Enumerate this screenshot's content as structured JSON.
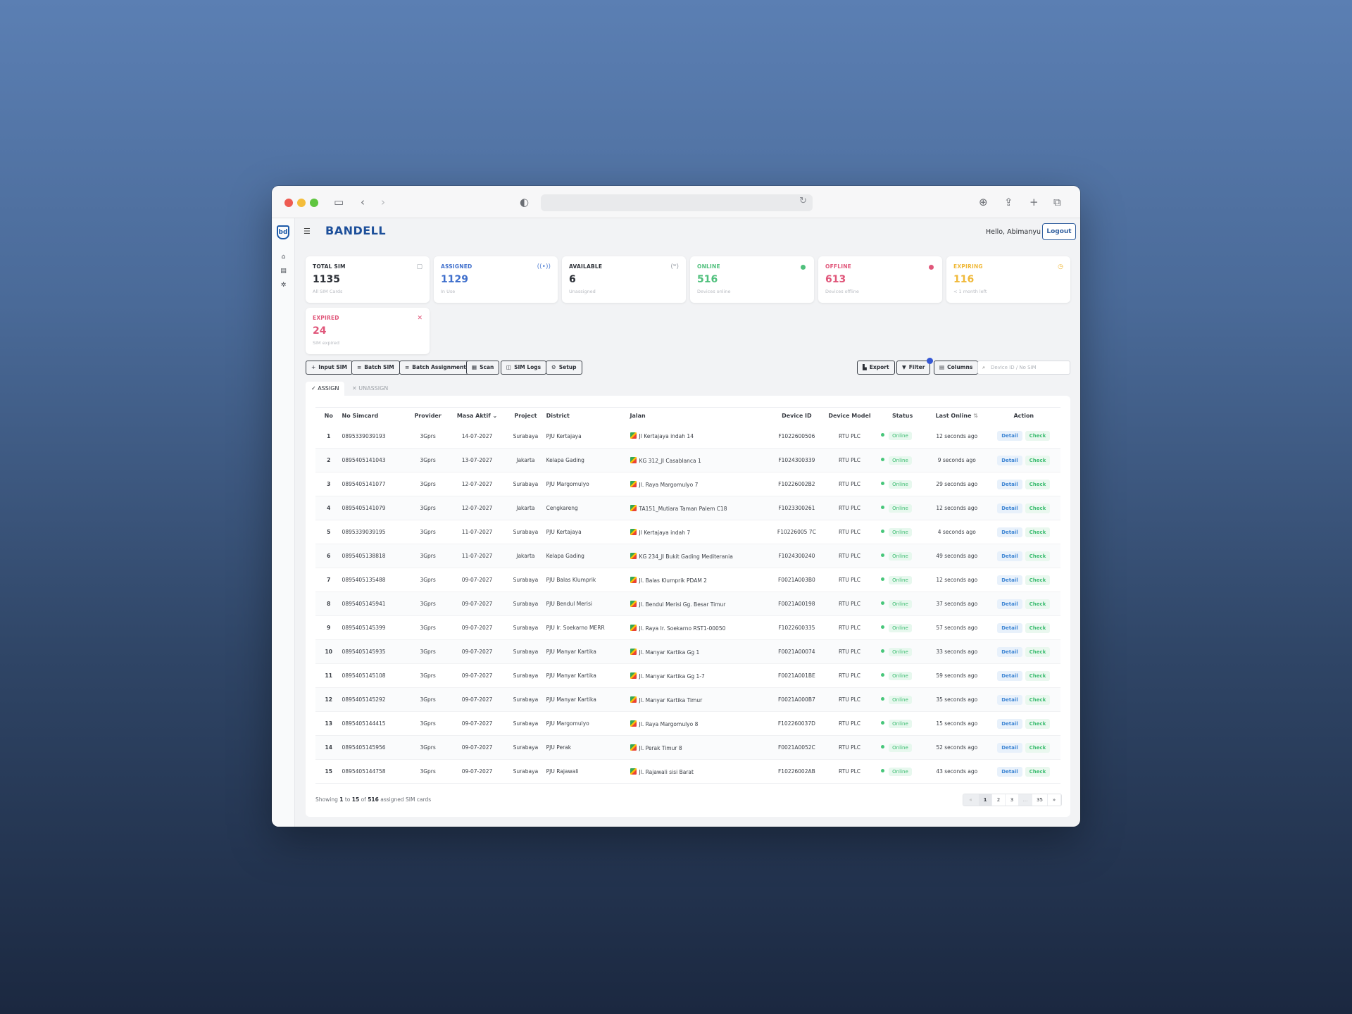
{
  "header": {
    "brand": "BANDELL",
    "greeting": "Hello, Abimanyu",
    "logout_label": "Logout"
  },
  "cards": [
    {
      "label": "TOTAL SIM",
      "value": "1135",
      "sub": "All SIM Cards",
      "color": "#2b2f36",
      "icon": "sim-card-icon"
    },
    {
      "label": "ASSIGNED",
      "value": "1129",
      "sub": "In Use",
      "color": "#3f6fcc",
      "icon": "signal-icon"
    },
    {
      "label": "AVAILABLE",
      "value": "6",
      "sub": "Unassigned",
      "color": "#2b2f36",
      "icon": "no-signal-icon"
    },
    {
      "label": "ONLINE",
      "value": "516",
      "sub": "Devices online",
      "color": "#4fc07c",
      "icon": "online-dot"
    },
    {
      "label": "OFFLINE",
      "value": "613",
      "sub": "Devices offline",
      "color": "#e0567a",
      "icon": "offline-dot"
    },
    {
      "label": "EXPIRING",
      "value": "116",
      "sub": "< 1 month left",
      "color": "#f0b93a",
      "icon": "clock-icon"
    },
    {
      "label": "EXPIRED",
      "value": "24",
      "sub": "SIM expired",
      "color": "#e0567a",
      "icon": "close-icon"
    }
  ],
  "toolbar": {
    "input_sim": "Input SIM",
    "batch_sim": "Batch SIM",
    "batch_assignment": "Batch Assignment",
    "scan": "Scan",
    "sim_logs": "SIM Logs",
    "setup": "Setup",
    "export": "Export",
    "filter": "Filter",
    "columns": "Columns",
    "search_placeholder": "Device ID / No SIM"
  },
  "tabs": {
    "assign": "ASSIGN",
    "unassign": "UNASSIGN"
  },
  "columns": [
    "No",
    "No Simcard",
    "Provider",
    "Masa Aktif",
    "Project",
    "District",
    "Jalan",
    "Device ID",
    "Device Model",
    "Status",
    "Last Online",
    "Action"
  ],
  "rows": [
    [
      "1",
      "0895339039193",
      "3Gprs",
      "14-07-2027",
      "Surabaya",
      "PJU Kertajaya",
      "Jl Kertajaya indah 14",
      "F1022600506",
      "RTU PLC",
      "Online",
      "12 seconds ago"
    ],
    [
      "2",
      "0895405141043",
      "3Gprs",
      "13-07-2027",
      "Jakarta",
      "Kelapa Gading",
      "KG 312_Jl Casablanca 1",
      "F1024300339",
      "RTU PLC",
      "Online",
      "9 seconds ago"
    ],
    [
      "3",
      "0895405141077",
      "3Gprs",
      "12-07-2027",
      "Surabaya",
      "PJU Margomulyo",
      "Jl. Raya Margomulyo 7",
      "F10226002B2",
      "RTU PLC",
      "Online",
      "29 seconds ago"
    ],
    [
      "4",
      "0895405141079",
      "3Gprs",
      "12-07-2027",
      "Jakarta",
      "Cengkareng",
      "TA151_Mutiara Taman Palem C18",
      "F1023300261",
      "RTU PLC",
      "Online",
      "12 seconds ago"
    ],
    [
      "5",
      "0895339039195",
      "3Gprs",
      "11-07-2027",
      "Surabaya",
      "PJU Kertajaya",
      "Jl Kertajaya indah 7",
      "F10226005 7C",
      "RTU PLC",
      "Online",
      "4 seconds ago"
    ],
    [
      "6",
      "0895405138818",
      "3Gprs",
      "11-07-2027",
      "Jakarta",
      "Kelapa Gading",
      "KG 234_Jl Bukit Gading Mediterania",
      "F1024300240",
      "RTU PLC",
      "Online",
      "49 seconds ago"
    ],
    [
      "7",
      "0895405135488",
      "3Gprs",
      "09-07-2027",
      "Surabaya",
      "PJU Balas Klumprik",
      "Jl. Balas Klumprik PDAM 2",
      "F0021A003B0",
      "RTU PLC",
      "Online",
      "12 seconds ago"
    ],
    [
      "8",
      "0895405145941",
      "3Gprs",
      "09-07-2027",
      "Surabaya",
      "PJU Bendul Merisi",
      "Jl. Bendul Merisi Gg. Besar Timur",
      "F0021A00198",
      "RTU PLC",
      "Online",
      "37 seconds ago"
    ],
    [
      "9",
      "0895405145399",
      "3Gprs",
      "09-07-2027",
      "Surabaya",
      "PJU Ir. Soekarno MERR",
      "Jl. Raya Ir. Soekarno RST1-00050",
      "F1022600335",
      "RTU PLC",
      "Online",
      "57 seconds ago"
    ],
    [
      "10",
      "0895405145935",
      "3Gprs",
      "09-07-2027",
      "Surabaya",
      "PJU Manyar Kartika",
      "Jl. Manyar Kartika Gg 1",
      "F0021A00074",
      "RTU PLC",
      "Online",
      "33 seconds ago"
    ],
    [
      "11",
      "0895405145108",
      "3Gprs",
      "09-07-2027",
      "Surabaya",
      "PJU Manyar Kartika",
      "Jl. Manyar Kartika Gg 1-7",
      "F0021A001BE",
      "RTU PLC",
      "Online",
      "59 seconds ago"
    ],
    [
      "12",
      "0895405145292",
      "3Gprs",
      "09-07-2027",
      "Surabaya",
      "PJU Manyar Kartika",
      "Jl. Manyar Kartika Timur",
      "F0021A000B7",
      "RTU PLC",
      "Online",
      "35 seconds ago"
    ],
    [
      "13",
      "0895405144415",
      "3Gprs",
      "09-07-2027",
      "Surabaya",
      "PJU Margomulyo",
      "Jl. Raya Margomulyo 8",
      "F102260037D",
      "RTU PLC",
      "Online",
      "15 seconds ago"
    ],
    [
      "14",
      "0895405145956",
      "3Gprs",
      "09-07-2027",
      "Surabaya",
      "PJU Perak",
      "Jl. Perak Timur 8",
      "F0021A0052C",
      "RTU PLC",
      "Online",
      "52 seconds ago"
    ],
    [
      "15",
      "0895405144758",
      "3Gprs",
      "09-07-2027",
      "Surabaya",
      "PJU Rajawali",
      "Jl. Rajawali sisi Barat",
      "F10226002AB",
      "RTU PLC",
      "Online",
      "43 seconds ago"
    ]
  ],
  "actions": {
    "detail": "Detail",
    "check": "Check"
  },
  "footer": {
    "showing_prefix": "Showing",
    "from": "1",
    "to_word": "to",
    "to": "15",
    "of_word": "of",
    "total": "516",
    "suffix": "assigned SIM cards"
  },
  "pagination": [
    "«",
    "1",
    "2",
    "3",
    "...",
    "35",
    "»"
  ]
}
